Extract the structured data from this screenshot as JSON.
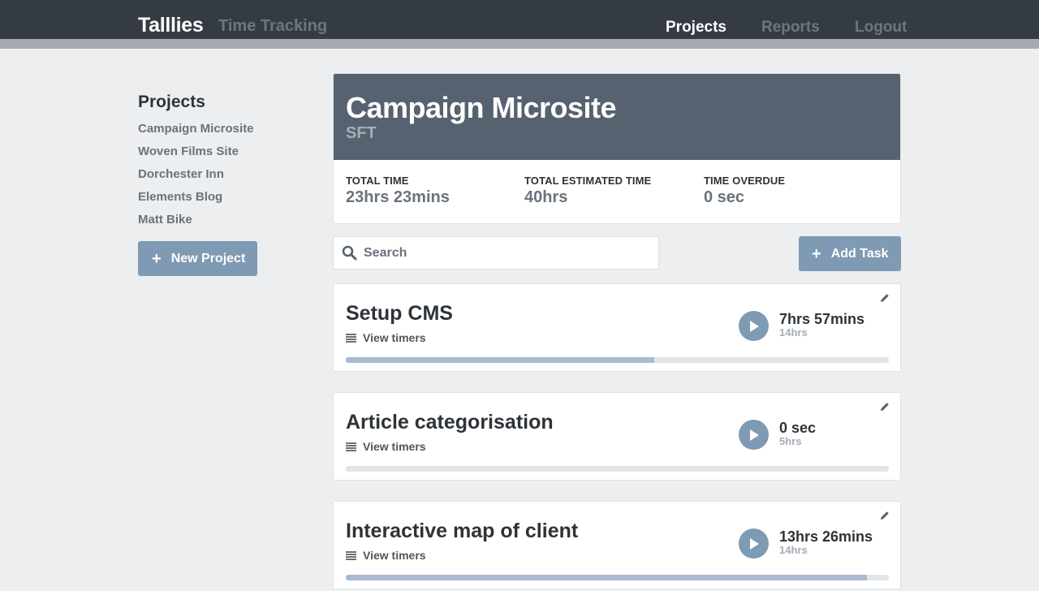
{
  "app": {
    "name": "Talllies",
    "tagline": "Time Tracking"
  },
  "nav": {
    "projects": "Projects",
    "reports": "Reports",
    "logout": "Logout"
  },
  "sidebar": {
    "heading": "Projects",
    "items": [
      "Campaign Microsite",
      "Woven Films Site",
      "Dorchester Inn",
      "Elements Blog",
      "Matt Bike"
    ],
    "new_project": "New Project"
  },
  "project": {
    "title": "Campaign Microsite",
    "code": "SFT",
    "stats": {
      "total_label": "TOTAL TIME",
      "total_value": "23hrs 23mins",
      "estimated_label": "TOTAL ESTIMATED TIME",
      "estimated_value": "40hrs",
      "overdue_label": "TIME OVERDUE",
      "overdue_value": "0 sec"
    }
  },
  "search": {
    "placeholder": "Search"
  },
  "add_task": "Add Task",
  "tasks": [
    {
      "name": "Setup CMS",
      "view_timers": "View timers",
      "logged": "7hrs 57mins",
      "estimate": "14hrs",
      "progress": 0.568
    },
    {
      "name": "Article categorisation",
      "view_timers": "View timers",
      "logged": "0 sec",
      "estimate": "5hrs",
      "progress": 0
    },
    {
      "name": "Interactive map of client",
      "view_timers": "View timers",
      "logged": "13hrs 26mins",
      "estimate": "14hrs",
      "progress": 0.96
    }
  ],
  "colors": {
    "topbar": "#353b43",
    "accent": "#7f9ab3",
    "header": "#56626f",
    "progress": "#a7bbcc"
  }
}
